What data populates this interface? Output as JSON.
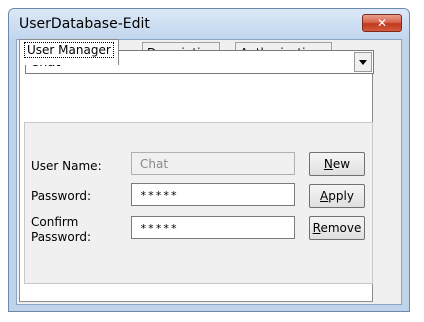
{
  "window": {
    "title": "UserDatabase-Edit",
    "close_glyph": "✕"
  },
  "tabs": [
    {
      "label": "User Manager",
      "active": true
    },
    {
      "label": "Description",
      "active": false
    },
    {
      "label": "Authorizations",
      "active": false
    }
  ],
  "user_select": {
    "value": "Chat"
  },
  "form": {
    "username_label": "User Name:",
    "username_value": "Chat",
    "password_label": "Password:",
    "password_value": "*****",
    "confirm_label_line1": "Confirm",
    "confirm_label_line2": "Password:",
    "confirm_value": "*****"
  },
  "buttons": {
    "new": {
      "mnemonic": "N",
      "rest": "ew"
    },
    "apply": {
      "mnemonic": "A",
      "rest": "pply"
    },
    "remove": {
      "mnemonic": "R",
      "rest": "emove"
    }
  },
  "colors": {
    "close_button": "#c0391f",
    "frame": "#bfd3ea"
  }
}
